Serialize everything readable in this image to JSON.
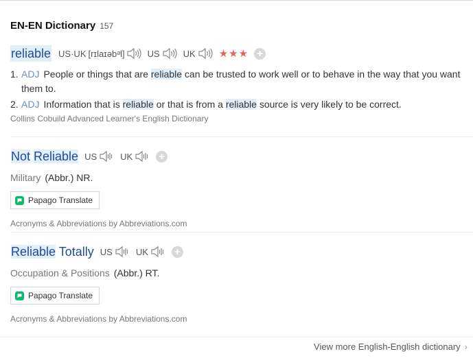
{
  "section": {
    "title": "EN-EN Dictionary",
    "count": "157"
  },
  "entries": [
    {
      "word": "reliable",
      "pron_us_uk_label": "US·UK",
      "phonetic": "[rɪlaɪəbᵊl]",
      "pron_us_label": "US",
      "pron_uk_label": "UK",
      "stars": "★★★",
      "definitions": [
        {
          "num": "1.",
          "pos": "ADJ",
          "parts": [
            "People or things that are ",
            "reliable",
            " can be trusted to work well or to behave in the way that you want them to."
          ]
        },
        {
          "num": "2.",
          "pos": "ADJ",
          "parts": [
            "Information that is ",
            "reliable",
            " or that is from a ",
            "reliable",
            " source is very likely to be correct."
          ]
        }
      ],
      "source": "Collins Cobuild Advanced Learner's English Dictionary"
    },
    {
      "word_parts": [
        "Not",
        " ",
        "Reliable"
      ],
      "pron_us_label": "US",
      "pron_uk_label": "UK",
      "field": "Military",
      "abbr": "(Abbr.) NR.",
      "papago_label": "Papago Translate",
      "source": "Acronyms & Abbreviations by Abbreviations.com"
    },
    {
      "word_parts": [
        "Reliable",
        " ",
        "Totally"
      ],
      "pron_us_label": "US",
      "pron_uk_label": "UK",
      "field": "Occupation & Positions",
      "abbr": "(Abbr.) RT.",
      "papago_label": "Papago Translate",
      "source": "Acronyms & Abbreviations by Abbreviations.com"
    }
  ],
  "footer": {
    "more_label": "View more English-English dictionary",
    "chevron": "›"
  },
  "icons": {
    "speaker": "speaker-icon",
    "plus": "plus-icon",
    "papago": "papago-icon",
    "chevron": "chevron-right-icon"
  },
  "colors": {
    "headword": "#1a4c9c",
    "highlight": "#e3eefb",
    "stars": "#e06458",
    "pos": "#6b8fc9"
  }
}
